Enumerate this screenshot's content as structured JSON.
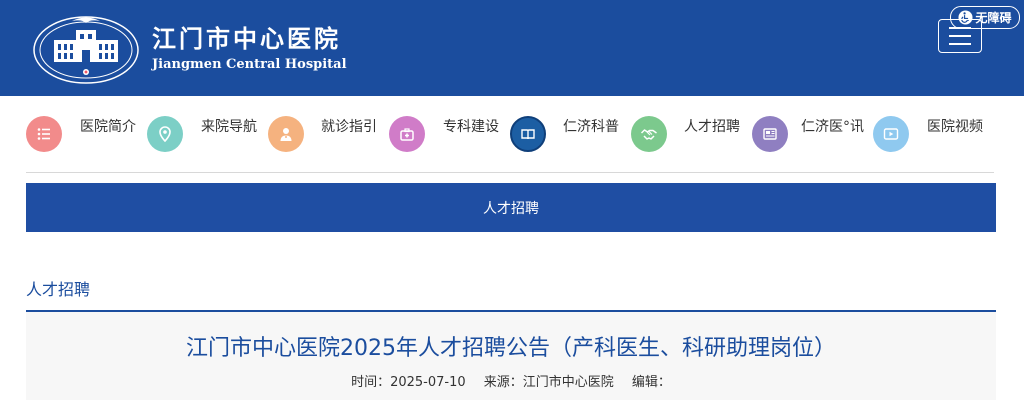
{
  "header": {
    "site_name": "江门市中心医院",
    "site_name_en": "Jiangmen Central Hospital",
    "accessibility_label": "无障碍",
    "brand_color": "#1b4d9e"
  },
  "nav": {
    "items": [
      {
        "label": "医院简介",
        "icon": "list-icon",
        "color": "#f28b8b"
      },
      {
        "label": "来院导航",
        "icon": "location-pin-icon",
        "color": "#7ccfc6"
      },
      {
        "label": "就诊指引",
        "icon": "doctor-icon",
        "color": "#f5b27f"
      },
      {
        "label": "专科建设",
        "icon": "medical-kit-icon",
        "color": "#d07cc8"
      },
      {
        "label": "仁济科普",
        "icon": "book-icon",
        "color": "#1c5ea3"
      },
      {
        "label": "人才招聘",
        "icon": "handshake-icon",
        "color": "#7cc98d"
      },
      {
        "label": "仁济医°讯",
        "icon": "newspaper-icon",
        "color": "#8f7fc1"
      },
      {
        "label": "医院视频",
        "icon": "video-icon",
        "color": "#8fc9ef"
      }
    ]
  },
  "banner": {
    "label": "人才招聘"
  },
  "section": {
    "title": "人才招聘"
  },
  "article": {
    "title": "江门市中心医院2025年人才招聘公告（产科医生、科研助理岗位）",
    "time_label": "时间：2025-07-10",
    "source_label": "来源：江门市中心医院",
    "editor_label": "编辑："
  }
}
